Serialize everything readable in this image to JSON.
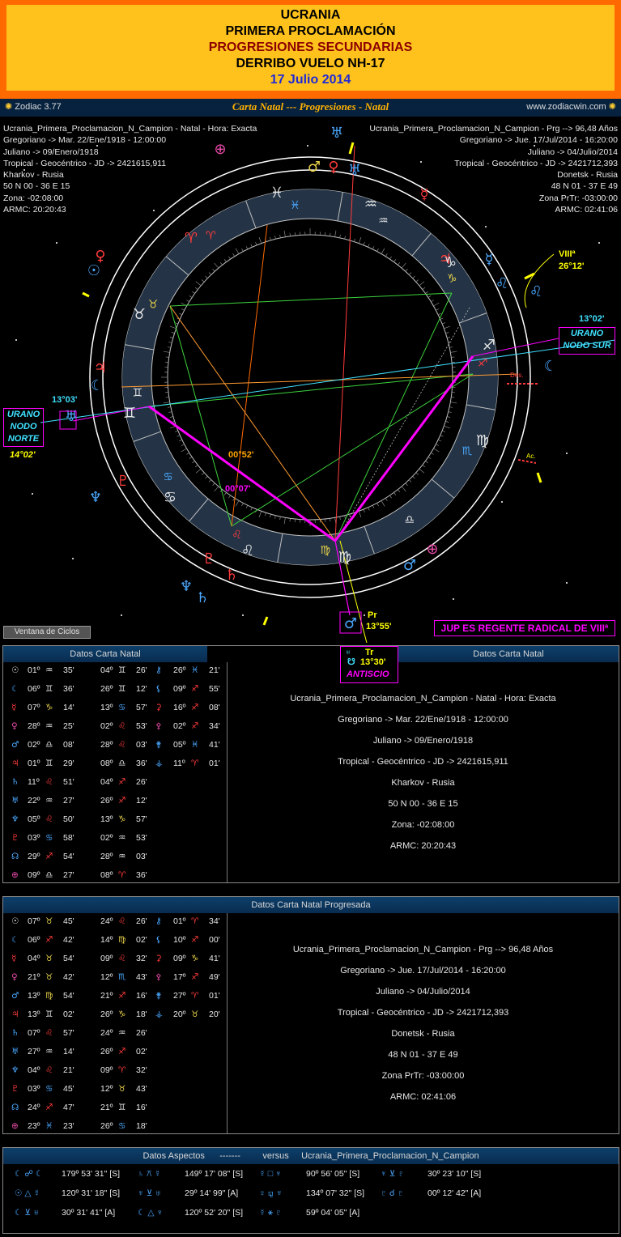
{
  "header": {
    "line1": "UCRANIA",
    "line2": "PRIMERA PROCLAMACIÓN",
    "line3": "PROGRESIONES SECUNDARIAS",
    "line4": "DERRIBO VUELO NH-17",
    "line5": "17 Julio 2014"
  },
  "titlebar": {
    "app": "Zodiac 3.77",
    "title": "Carta Natal --- Progresiones - Natal",
    "site": "www.zodiacwin.com"
  },
  "info_left": [
    "Ucrania_Primera_Proclamacion_N_Campion - Natal - Hora: Exacta",
    "Gregoriano -> Mar. 22/Ene/1918 - 12:00:00",
    "Juliano -> 09/Enero/1918",
    "Tropical - Geocéntrico - JD -> 2421615,911",
    "Kharkov - Rusia",
    "50 N 00 - 36 E 15",
    "Zona: -02:08:00",
    "ARMC: 20:20:43"
  ],
  "info_right": [
    "Ucrania_Primera_Proclamacion_N_Campion - Prg --> 96,48 Años",
    "Gregoriano -> Jue. 17/Jul/2014 - 16:20:00",
    "Juliano -> 04/Julio/2014",
    "Tropical - Geocéntrico - JD -> 2421712,393",
    "Donetsk - Rusia",
    "48 N 01 - 37 E 49",
    "Zona PrTr: -03:00:00",
    "ARMC: 02:41:06"
  ],
  "chart_labels": {
    "viii_house": "VIIIª",
    "viii_deg": "26°12'",
    "urano_ns_deg": "13°02'",
    "urano_ns": "URANO\nNODO SUR",
    "urano_nn_deg": "13°03'",
    "urano_nn": "URANO\nNODO\nNORTE",
    "urano_nn_deg2": "14°02'",
    "angle1": "00°52'",
    "angle2": "00°07'",
    "pr_label": "Pr",
    "pr_deg": "13°55'",
    "tr_label": "Tr",
    "tr_deg": "13°30'",
    "antiscio": "ANTISCIO",
    "jup_note": "JUP ES REGENTE RADICAL DE VIIIª",
    "ventana": "Ventana de Ciclos",
    "des": "Des.",
    "asc": "Ac."
  },
  "natal_panel": {
    "left_title": "Datos Carta Natal",
    "right_title": "Datos Carta Natal",
    "rows": [
      [
        "☉",
        "01º",
        "♒",
        "35'",
        "04º",
        "♊",
        "26'",
        "⚷",
        "26º",
        "♓",
        "21'"
      ],
      [
        "☾",
        "06º",
        "♊",
        "36'",
        "26º",
        "♊",
        "12'",
        "⚸",
        "09º",
        "♐",
        "55'"
      ],
      [
        "☿",
        "07º",
        "♑",
        "14'",
        "13º",
        "♋",
        "57'",
        "⚳",
        "16º",
        "♐",
        "08'"
      ],
      [
        "♀",
        "28º",
        "♒",
        "25'",
        "02º",
        "♌",
        "53'",
        "⚴",
        "02º",
        "♐",
        "34'"
      ],
      [
        "♂",
        "02º",
        "♎",
        "08'",
        "28º",
        "♌",
        "03'",
        "⚵",
        "05º",
        "♓",
        "41'"
      ],
      [
        "♃",
        "01º",
        "♊",
        "29'",
        "08º",
        "♎",
        "36'",
        "⚶",
        "11º",
        "♈",
        "01'"
      ],
      [
        "♄",
        "11º",
        "♌",
        "51'",
        "04º",
        "♐",
        "26'",
        "",
        "",
        "",
        ""
      ],
      [
        "♅",
        "22º",
        "♒",
        "27'",
        "26º",
        "♐",
        "12'",
        "",
        "",
        "",
        ""
      ],
      [
        "♆",
        "05º",
        "♌",
        "50'",
        "13º",
        "♑",
        "57'",
        "",
        "",
        "",
        ""
      ],
      [
        "♇",
        "03º",
        "♋",
        "58'",
        "02º",
        "♒",
        "53'",
        "",
        "",
        "",
        ""
      ],
      [
        "☊",
        "29º",
        "♐",
        "54'",
        "28º",
        "♒",
        "03'",
        "",
        "",
        "",
        ""
      ],
      [
        "⊕",
        "09º",
        "♎",
        "27'",
        "08º",
        "♈",
        "36'",
        "",
        "",
        "",
        ""
      ]
    ],
    "meta": [
      "Ucrania_Primera_Proclamacion_N_Campion - Natal - Hora: Exacta",
      "Gregoriano -> Mar. 22/Ene/1918 - 12:00:00",
      "Juliano -> 09/Enero/1918",
      "Tropical - Geocéntrico - JD -> 2421615,911",
      "Kharkov - Rusia",
      "50 N 00 - 36 E 15",
      "Zona: -02:08:00",
      "ARMC: 20:20:43"
    ]
  },
  "prog_panel": {
    "title": "Datos Carta Natal Progresada",
    "rows": [
      [
        "☉",
        "07º",
        "♉",
        "45'",
        "24º",
        "♌",
        "26'",
        "⚷",
        "01º",
        "♈",
        "34'"
      ],
      [
        "☾",
        "06º",
        "♐",
        "42'",
        "14º",
        "♍",
        "02'",
        "⚸",
        "10º",
        "♐",
        "00'"
      ],
      [
        "☿",
        "04º",
        "♉",
        "54'",
        "09º",
        "♌",
        "32'",
        "⚳",
        "09º",
        "♑",
        "41'"
      ],
      [
        "♀",
        "21º",
        "♉",
        "42'",
        "12º",
        "♏",
        "43'",
        "⚴",
        "17º",
        "♐",
        "49'"
      ],
      [
        "♂",
        "13º",
        "♍",
        "54'",
        "21º",
        "♐",
        "16'",
        "⚵",
        "27º",
        "♈",
        "01'"
      ],
      [
        "♃",
        "13º",
        "♊",
        "02'",
        "26º",
        "♑",
        "18'",
        "⚶",
        "20º",
        "♉",
        "20'"
      ],
      [
        "♄",
        "07º",
        "♌",
        "57'",
        "24º",
        "♒",
        "26'",
        "",
        "",
        "",
        ""
      ],
      [
        "♅",
        "27º",
        "♒",
        "14'",
        "26º",
        "♐",
        "02'",
        "",
        "",
        "",
        ""
      ],
      [
        "♆",
        "04º",
        "♌",
        "21'",
        "09º",
        "♈",
        "32'",
        "",
        "",
        "",
        ""
      ],
      [
        "♇",
        "03º",
        "♋",
        "45'",
        "12º",
        "♉",
        "43'",
        "",
        "",
        "",
        ""
      ],
      [
        "☊",
        "24º",
        "♐",
        "47'",
        "21º",
        "♊",
        "16'",
        "",
        "",
        "",
        ""
      ],
      [
        "⊕",
        "23º",
        "♓",
        "23'",
        "26º",
        "♋",
        "18'",
        "",
        "",
        "",
        ""
      ]
    ],
    "meta": [
      "Ucrania_Primera_Proclamacion_N_Campion - Prg --> 96,48 Años",
      "Gregoriano -> Jue. 17/Jul/2014 - 16:20:00",
      "Juliano -> 04/Julio/2014",
      "Tropical - Geocéntrico - JD -> 2421712,393",
      "Donetsk - Rusia",
      "48 N 01 - 37 E 49",
      "Zona PrTr: -03:00:00",
      "ARMC: 02:41:06"
    ]
  },
  "aspects_panel": {
    "title_a": "Datos Aspectos",
    "title_b": "-------",
    "title_c": "versus",
    "title_d": "Ucrania_Primera_Proclamacion_N_Campion",
    "rows": [
      [
        [
          "☾ ☍ ☾",
          "179º 53' 31\" [S]"
        ],
        [
          "♄ ⚻ ☿",
          "149º 17' 08\" [S]"
        ],
        [
          "☿ □ ♆",
          "90º 56' 05\" [S]"
        ],
        [
          "♆ ⊻ ♇",
          "30º 23' 10\" [S]"
        ]
      ],
      [
        [
          "☉ △ ☿",
          "120º 31' 18\" [S]"
        ],
        [
          "♆ ⊻ ♅",
          "29º 14' 99\" [A]"
        ],
        [
          "♀ ⚼ ♆",
          "134º 07' 32\" [S]"
        ],
        [
          "♇ ☌ ♇",
          "00º 12' 42\" [A]"
        ]
      ],
      [
        [
          "☾ ⊻ ♅",
          "30º 31' 41\" [A]"
        ],
        [
          "☾ △ ♆",
          "120º 52' 20\" [S]"
        ],
        [
          "☿ ⚹ ♇",
          "59º 04' 05\" [A]"
        ],
        [
          "",
          ""
        ]
      ]
    ]
  },
  "colors": {
    "header_outer": "#ff6a00",
    "header_inner": "#ffc21c",
    "magenta": "#ff00ff",
    "cyan": "#40e0ff",
    "yellow": "#ffff00",
    "ring": "#1a2a3a"
  }
}
